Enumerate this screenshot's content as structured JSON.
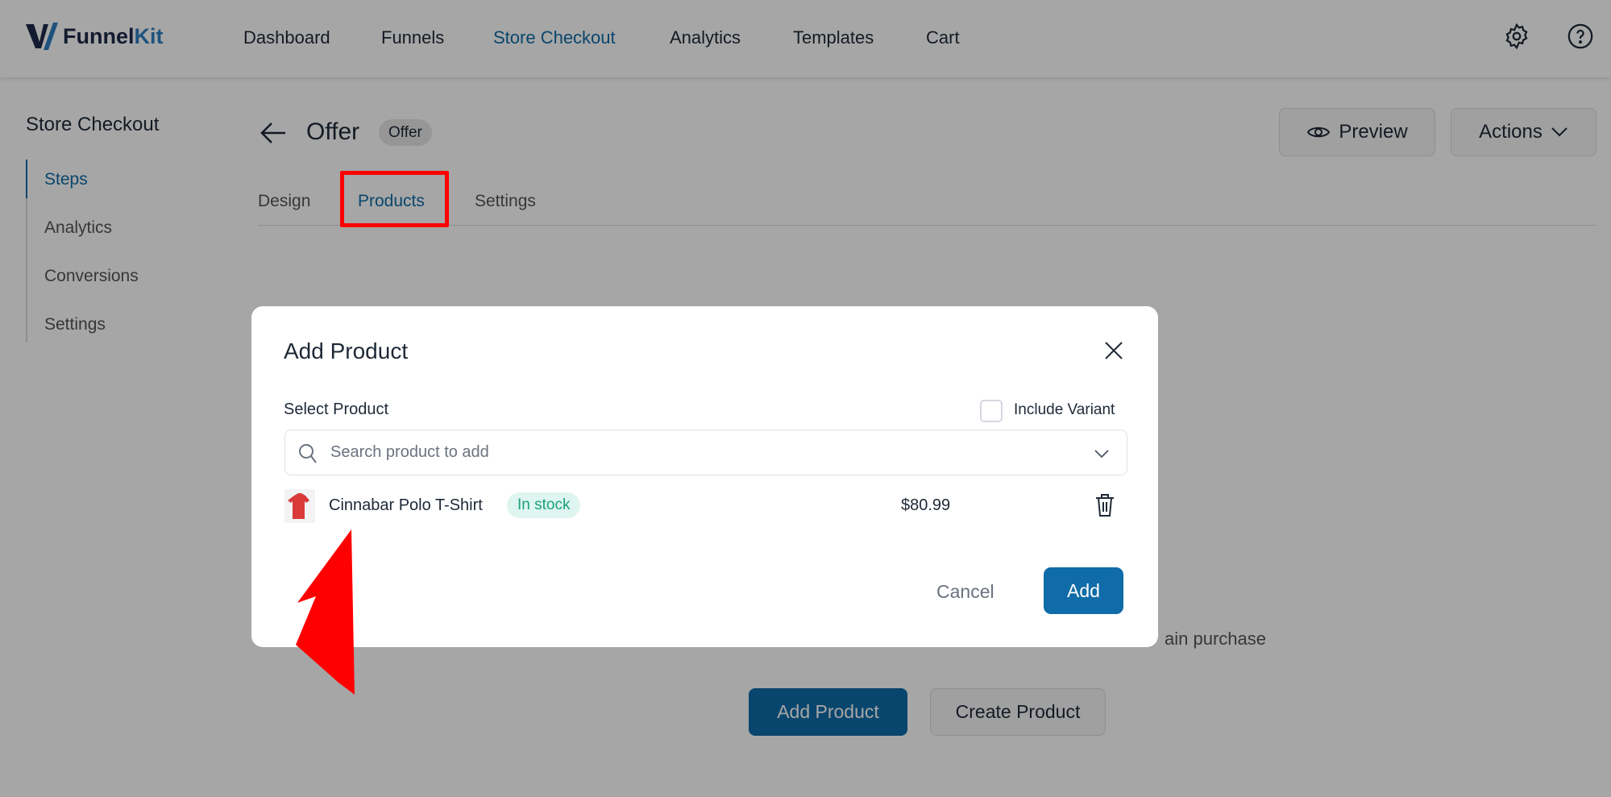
{
  "header": {
    "logo_text": "FunnelKit",
    "nav": [
      {
        "label": "Dashboard"
      },
      {
        "label": "Funnels"
      },
      {
        "label": "Store Checkout",
        "active": true
      },
      {
        "label": "Analytics"
      },
      {
        "label": "Templates"
      },
      {
        "label": "Cart"
      }
    ],
    "icons": [
      "gear-icon",
      "help-icon"
    ]
  },
  "sidebar": {
    "title": "Store Checkout",
    "items": [
      {
        "label": "Steps",
        "active": true
      },
      {
        "label": "Analytics"
      },
      {
        "label": "Conversions"
      },
      {
        "label": "Settings"
      }
    ]
  },
  "page": {
    "title": "Offer",
    "badge": "Offer",
    "preview_label": "Preview",
    "actions_label": "Actions",
    "tabs": [
      {
        "label": "Design"
      },
      {
        "label": "Products",
        "active": true
      },
      {
        "label": "Settings"
      }
    ],
    "empty_text_fragment": "ain purchase",
    "add_product_label": "Add Product",
    "create_product_label": "Create Product"
  },
  "modal": {
    "title": "Add Product",
    "select_label": "Select Product",
    "include_variant_label": "Include Variant",
    "include_variant_checked": false,
    "search_placeholder": "Search product to add",
    "product": {
      "name": "Cinnabar Polo T-Shirt",
      "stock": "In stock",
      "price": "$80.99"
    },
    "cancel_label": "Cancel",
    "add_label": "Add"
  },
  "colors": {
    "accent": "#0f6ca8",
    "highlight": "#ff0000",
    "stock_bg": "#dff5ef",
    "stock_text": "#1aa37a"
  }
}
